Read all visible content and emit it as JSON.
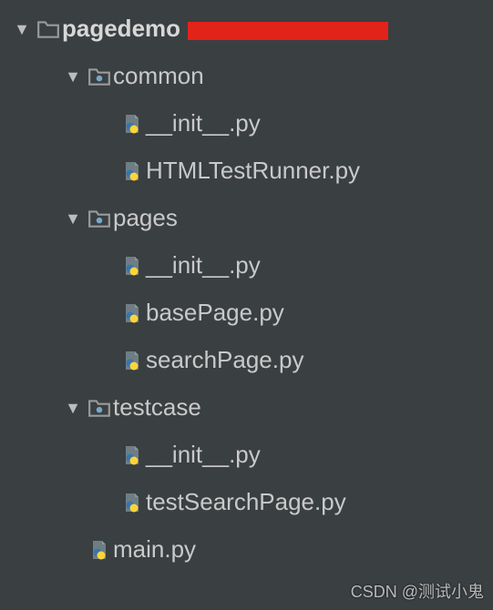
{
  "colors": {
    "bg": "#3a3f41",
    "text": "#c9c9c9",
    "redaction": "#e2231a",
    "folder_outline": "#8c8c8c",
    "package_dot": "#7aa7c7",
    "py_page": "#7b8a93",
    "py_blue": "#3776ab",
    "py_yellow": "#ffd43b"
  },
  "tree": {
    "root": {
      "name": "pagedemo",
      "expanded": true,
      "redacted_suffix": true,
      "children": [
        {
          "name": "common",
          "type": "package",
          "expanded": true,
          "files": [
            {
              "name": "__init__.py"
            },
            {
              "name": "HTMLTestRunner.py"
            }
          ]
        },
        {
          "name": "pages",
          "type": "package",
          "expanded": true,
          "files": [
            {
              "name": "__init__.py"
            },
            {
              "name": "basePage.py"
            },
            {
              "name": "searchPage.py"
            }
          ]
        },
        {
          "name": "testcase",
          "type": "package",
          "expanded": true,
          "files": [
            {
              "name": "__init__.py"
            },
            {
              "name": "testSearchPage.py"
            }
          ]
        },
        {
          "name": "main.py",
          "type": "pyfile"
        }
      ]
    }
  },
  "watermark": "CSDN @测试小鬼"
}
